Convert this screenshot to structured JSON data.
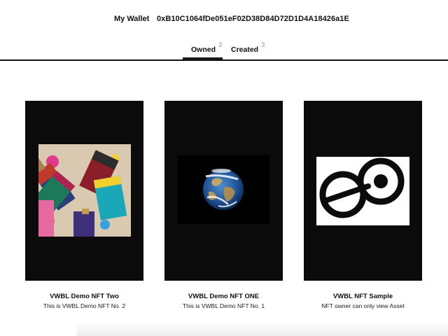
{
  "wallet": {
    "label": "My Wallet",
    "address": "0xB10C1064fDe051eF02D38D84D72D1D4A18426a1E"
  },
  "tabs": [
    {
      "label": "Owned",
      "count": "3",
      "active": true
    },
    {
      "label": "Created",
      "count": "3",
      "active": false
    }
  ],
  "nfts": [
    {
      "title": "VWBL Demo NFT Two",
      "description": "This is VWBL Demo NFT No. 2",
      "image": "paint-brushes-photo"
    },
    {
      "title": "VWBL Demo NFT ONE",
      "description": "This is VWBL Demo NFT No. 1",
      "image": "earth-photo"
    },
    {
      "title": "VWBL NFT Sample",
      "description": "NFT owner can only view Asset",
      "image": "vwbl-logo"
    }
  ],
  "colors": {
    "card_background": "#0b0b0b",
    "tab_count": "#8a97a8",
    "divider": "#111111"
  }
}
